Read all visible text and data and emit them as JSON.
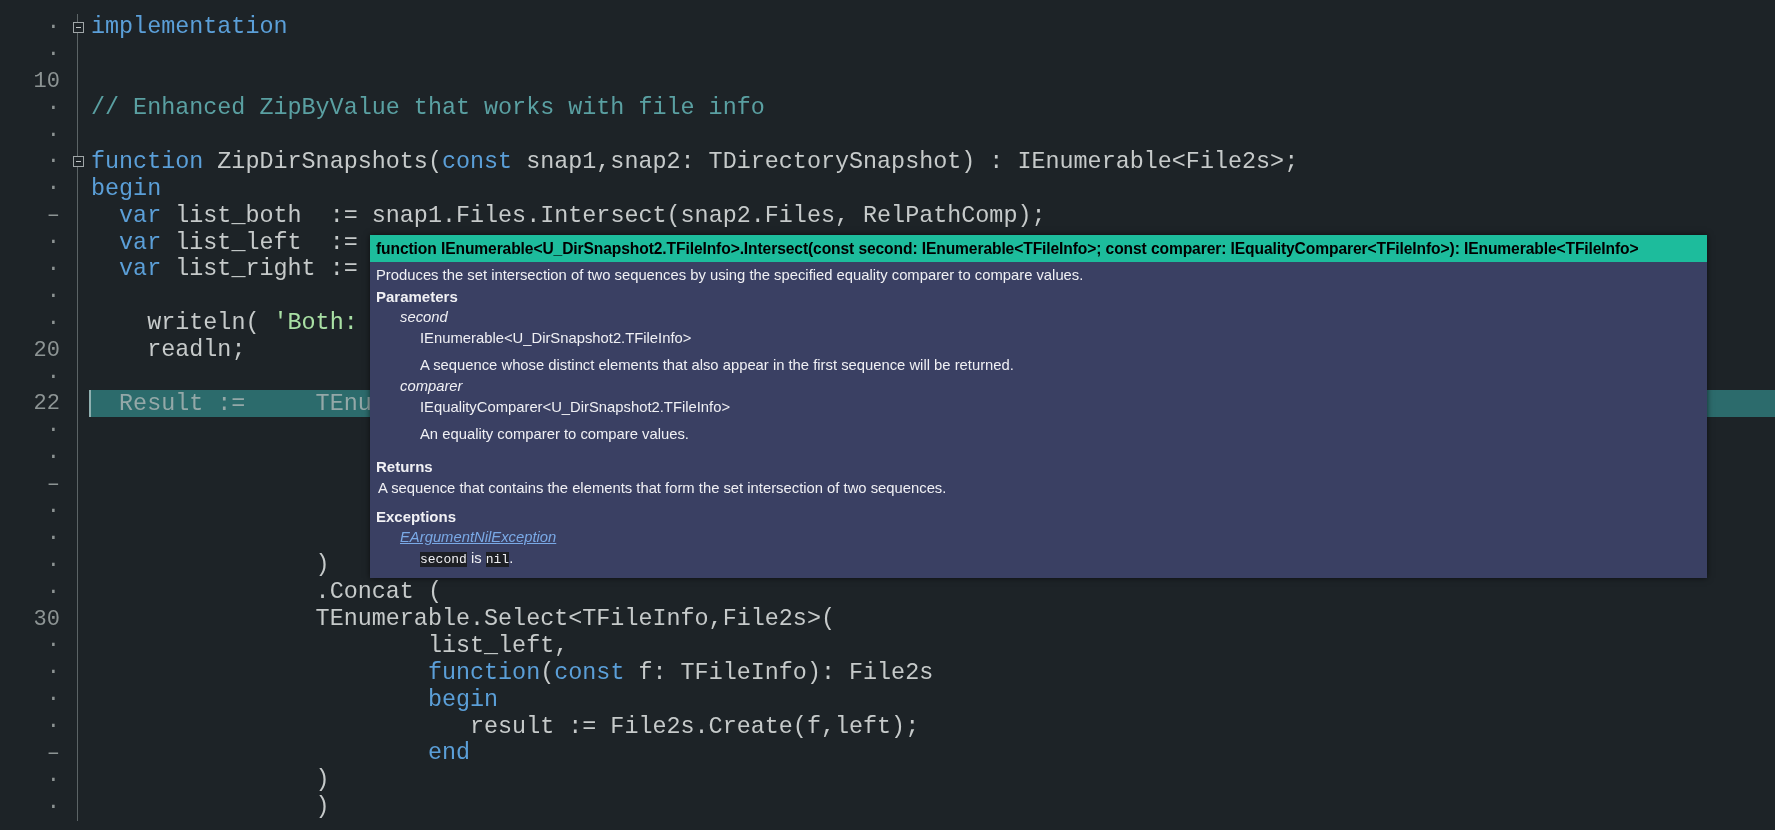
{
  "editor": {
    "lines": [
      {
        "gutter": "·",
        "fold_box": true,
        "current": false,
        "tokens": [
          {
            "text": "implementation",
            "kind": "kw"
          }
        ]
      },
      {
        "gutter": "·",
        "fold_box": false,
        "current": false
      },
      {
        "gutter": "10",
        "fold_box": false,
        "current": false
      },
      {
        "gutter": "·",
        "fold_box": false,
        "current": false,
        "tokens": [
          {
            "text": "// Enhanced ZipByValue that works with file info",
            "kind": "comment"
          }
        ]
      },
      {
        "gutter": "·",
        "fold_box": false,
        "current": false
      },
      {
        "gutter": "·",
        "fold_box": true,
        "current": false,
        "tokens": [
          {
            "text": "function",
            "kind": "kw"
          },
          {
            "text": " ZipDirSnapshots(",
            "kind": "id"
          },
          {
            "text": "const",
            "kind": "kw"
          },
          {
            "text": " snap1,snap2: TDirectorySnapshot) : IEnumerable<File2s>;",
            "kind": "id"
          }
        ]
      },
      {
        "gutter": "·",
        "fold_box": false,
        "current": false,
        "tokens": [
          {
            "text": "begin",
            "kind": "kw"
          }
        ]
      },
      {
        "gutter": "–",
        "fold_box": false,
        "current": false,
        "tokens": [
          {
            "text": "  var",
            "kind": "kw"
          },
          {
            "text": " list_both  := snap1.Files.Intersect(snap2.Files, RelPathComp);",
            "kind": "id"
          }
        ]
      },
      {
        "gutter": "·",
        "fold_box": false,
        "current": false,
        "tokens": [
          {
            "text": "  var",
            "kind": "kw"
          },
          {
            "text": " list_left  :=",
            "kind": "id"
          }
        ]
      },
      {
        "gutter": "·",
        "fold_box": false,
        "current": false,
        "tokens": [
          {
            "text": "  var",
            "kind": "kw"
          },
          {
            "text": " list_right :=",
            "kind": "id"
          }
        ]
      },
      {
        "gutter": "·",
        "fold_box": false,
        "current": false
      },
      {
        "gutter": "·",
        "fold_box": false,
        "current": false,
        "tokens": [
          {
            "text": "    writeln( ",
            "kind": "id"
          },
          {
            "text": "'Both:",
            "kind": "str"
          }
        ]
      },
      {
        "gutter": "20",
        "fold_box": false,
        "current": false,
        "tokens": [
          {
            "text": "    readln;",
            "kind": "id"
          }
        ]
      },
      {
        "gutter": "·",
        "fold_box": false,
        "current": false
      },
      {
        "gutter": "22",
        "fold_box": false,
        "current": true,
        "tokens": [
          {
            "text": "  Result :=     TEnu",
            "kind": "id"
          }
        ]
      },
      {
        "gutter": "·",
        "fold_box": false,
        "current": false
      },
      {
        "gutter": "·",
        "fold_box": false,
        "current": false
      },
      {
        "gutter": "–",
        "fold_box": false,
        "current": false
      },
      {
        "gutter": "·",
        "fold_box": false,
        "current": false
      },
      {
        "gutter": "·",
        "fold_box": false,
        "current": false
      },
      {
        "gutter": "·",
        "fold_box": false,
        "current": false,
        "tokens": [
          {
            "text": "                )",
            "kind": "id"
          }
        ]
      },
      {
        "gutter": "·",
        "fold_box": false,
        "current": false,
        "tokens": [
          {
            "text": "                .Concat (",
            "kind": "id"
          }
        ]
      },
      {
        "gutter": "30",
        "fold_box": false,
        "current": false,
        "tokens": [
          {
            "text": "                TEnumerable.Select<TFileInfo,File2s>(",
            "kind": "id"
          }
        ]
      },
      {
        "gutter": "·",
        "fold_box": false,
        "current": false,
        "tokens": [
          {
            "text": "                        list_left,",
            "kind": "id"
          }
        ]
      },
      {
        "gutter": "·",
        "fold_box": false,
        "current": false,
        "tokens": [
          {
            "text": "                        function",
            "kind": "kw"
          },
          {
            "text": "(",
            "kind": "id"
          },
          {
            "text": "const",
            "kind": "kw"
          },
          {
            "text": " f: TFileInfo): File2s",
            "kind": "id"
          }
        ]
      },
      {
        "gutter": "·",
        "fold_box": false,
        "current": false,
        "tokens": [
          {
            "text": "                        begin",
            "kind": "kw"
          }
        ]
      },
      {
        "gutter": "·",
        "fold_box": false,
        "current": false,
        "tokens": [
          {
            "text": "                           result := File2s.Create(f,left);",
            "kind": "id"
          }
        ]
      },
      {
        "gutter": "–",
        "fold_box": false,
        "current": false,
        "tokens": [
          {
            "text": "                        end",
            "kind": "kw"
          }
        ]
      },
      {
        "gutter": "·",
        "fold_box": false,
        "current": false,
        "tokens": [
          {
            "text": "                )",
            "kind": "id"
          }
        ]
      },
      {
        "gutter": "·",
        "fold_box": false,
        "current": false,
        "tokens": [
          {
            "text": "                )",
            "kind": "id"
          }
        ]
      }
    ]
  },
  "tooltip": {
    "signature": "function IEnumerable<U_DirSnapshot2.TFileInfo>.Intersect(const second: IEnumerable<TFileInfo>; const comparer: IEqualityComparer<TFileInfo>): IEnumerable<TFileInfo>",
    "summary": "Produces the set intersection of two sequences by using the specified equality comparer to compare values.",
    "parameters_heading": "Parameters",
    "parameters": [
      {
        "name": "second",
        "type": "IEnumerable<U_DirSnapshot2.TFileInfo>",
        "description": "A sequence whose distinct elements that also appear in the first sequence will be returned."
      },
      {
        "name": "comparer",
        "type": "IEqualityComparer<U_DirSnapshot2.TFileInfo>",
        "description": "An equality comparer to compare values."
      }
    ],
    "returns_heading": "Returns",
    "returns": "A sequence that contains the elements that form the set intersection of two sequences.",
    "exceptions_heading": "Exceptions",
    "exceptions": [
      {
        "name": "EArgumentNilException",
        "condition": [
          {
            "text": "second",
            "kind": "code"
          },
          {
            "text": " is ",
            "kind": "plain"
          },
          {
            "text": "nil",
            "kind": "code"
          },
          {
            "text": ".",
            "kind": "plain"
          }
        ]
      }
    ]
  }
}
